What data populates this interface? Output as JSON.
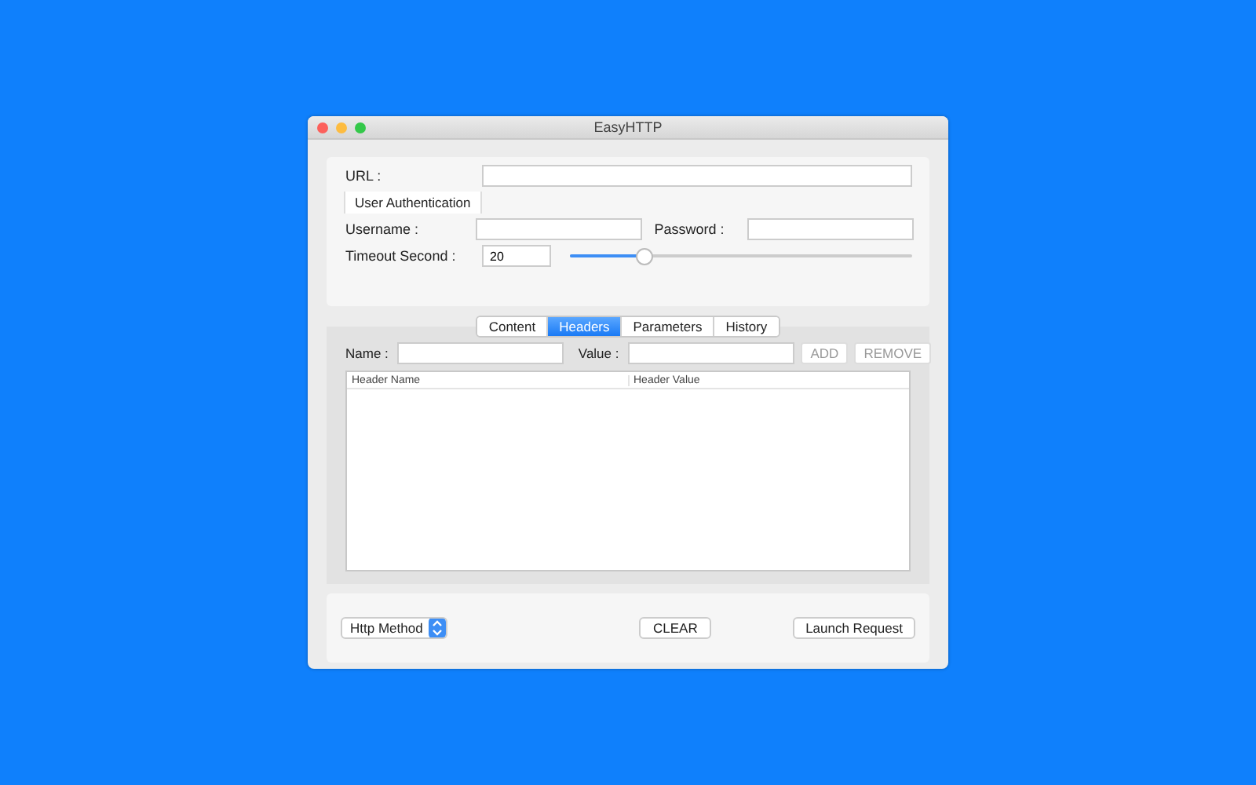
{
  "window": {
    "title": "EasyHTTP"
  },
  "request": {
    "url_label": "URL :",
    "auth_label": "User Authentication",
    "username_label": "Username :",
    "password_label": "Password :",
    "timeout_label": "Timeout Second :",
    "timeout_value": "20",
    "timeout_slider": {
      "level": 0.22
    }
  },
  "tabs": [
    {
      "label": "Content",
      "selected": false
    },
    {
      "label": "Headers",
      "selected": true
    },
    {
      "label": "Parameters",
      "selected": false
    },
    {
      "label": "History",
      "selected": false
    }
  ],
  "headers": {
    "name_label": "Name :",
    "value_label": "Value :",
    "buttons": [
      {
        "label": "ADD",
        "disabled": true
      },
      {
        "label": "REMOVE",
        "disabled": true
      }
    ],
    "table": {
      "columns": [
        "Header Name",
        "Header Value"
      ]
    }
  },
  "footer": {
    "method": "Http Method",
    "clear": "CLEAR",
    "launch": "Launch Request"
  }
}
